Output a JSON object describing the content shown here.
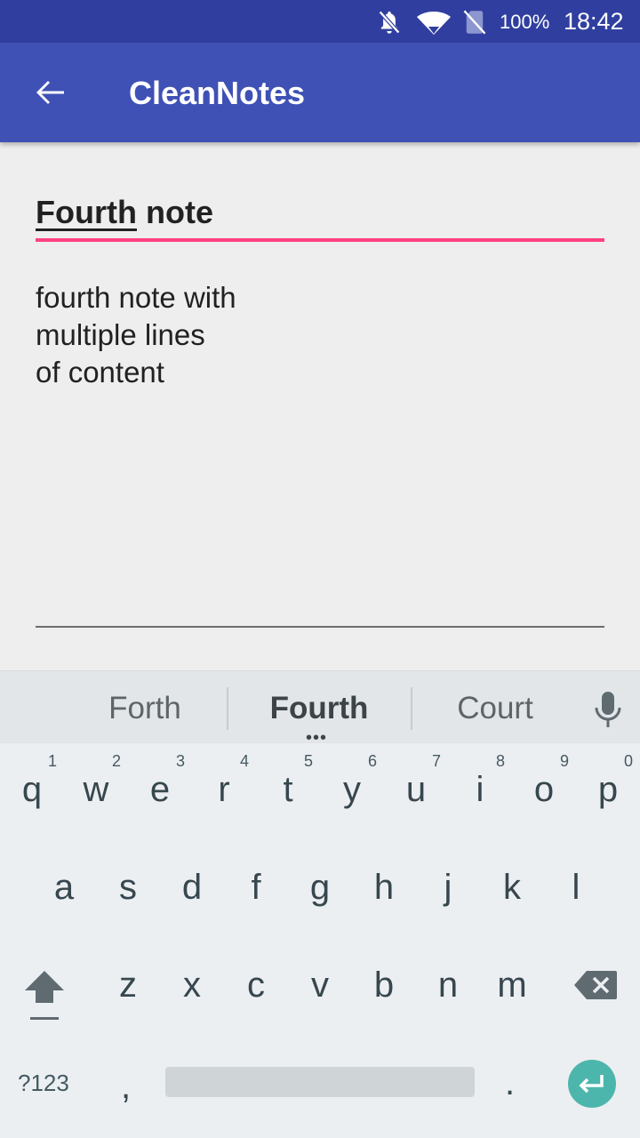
{
  "status_bar": {
    "battery_text": "100%",
    "clock": "18:42",
    "icons": [
      "notifications-off-icon",
      "wifi-icon",
      "no-sim-icon"
    ]
  },
  "app_bar": {
    "title": "CleanNotes",
    "back_icon": "arrow-back-icon"
  },
  "note": {
    "title_word_underlined": "Fourth",
    "title_rest": " note",
    "body_lines": [
      "fourth note with",
      "multiple lines",
      "of content"
    ]
  },
  "keyboard": {
    "suggestions": [
      "Forth",
      "Fourth",
      "Court"
    ],
    "row1": [
      {
        "key": "q",
        "hint": "1"
      },
      {
        "key": "w",
        "hint": "2"
      },
      {
        "key": "e",
        "hint": "3"
      },
      {
        "key": "r",
        "hint": "4"
      },
      {
        "key": "t",
        "hint": "5"
      },
      {
        "key": "y",
        "hint": "6"
      },
      {
        "key": "u",
        "hint": "7"
      },
      {
        "key": "i",
        "hint": "8"
      },
      {
        "key": "o",
        "hint": "9"
      },
      {
        "key": "p",
        "hint": "0"
      }
    ],
    "row2": [
      "a",
      "s",
      "d",
      "f",
      "g",
      "h",
      "j",
      "k",
      "l"
    ],
    "row3": [
      "z",
      "x",
      "c",
      "v",
      "b",
      "n",
      "m"
    ],
    "symbols_label": "?123",
    "comma": ",",
    "period": ".",
    "accent_color": "#4db6ac"
  },
  "colors": {
    "primary": "#3f51b5",
    "primary_dark": "#303f9f",
    "accent": "#ff4081"
  }
}
